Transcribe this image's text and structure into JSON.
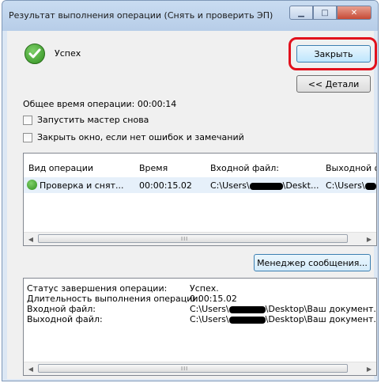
{
  "window": {
    "title": "Результат выполнения операции (Снять и проверить ЭП)",
    "buttons": {
      "minimize": "▁",
      "maximize": "□",
      "close": "✕"
    }
  },
  "result": {
    "status_text": "Успех",
    "total_time": "Общее время операции: 00:00:14"
  },
  "options": {
    "restart_wizard": "Запустить мастер снова",
    "close_if_no_errors": "Закрыть окно, если нет ошибок и замечаний"
  },
  "actions": {
    "close": "Закрыть",
    "details": "<< Детали",
    "message_manager": "Менеджер сообщения..."
  },
  "table": {
    "headers": [
      "Вид операции",
      "Время",
      "Входной файл:",
      "Выходной ф"
    ],
    "rows": [
      {
        "operation": "Проверка и снят...",
        "time": "00:00:15.02",
        "input_prefix": "C:\\Users\\",
        "input_suffix": "\\Deskt...",
        "output_prefix": "C:\\Users\\"
      }
    ]
  },
  "scroll": {
    "left": "◀",
    "right": "▶",
    "grip": "III"
  },
  "status": {
    "rows": [
      {
        "label": "Статус завершения операции:",
        "value": "Успех."
      },
      {
        "label": "Длительность выполнения операции:",
        "value": "0:00:15.02"
      },
      {
        "label": "Входной файл:",
        "value_prefix": "C:\\Users\\",
        "value_suffix": "\\Desktop\\Ваш документ.c"
      },
      {
        "label": "Выходной файл:",
        "value_prefix": "C:\\Users\\",
        "value_suffix": "\\Desktop\\Ваш документ.c"
      }
    ]
  },
  "colors": {
    "highlight_ring": "#e2101c",
    "success_green": "#2f8f1e",
    "selected_row": "#e6f0fa"
  }
}
